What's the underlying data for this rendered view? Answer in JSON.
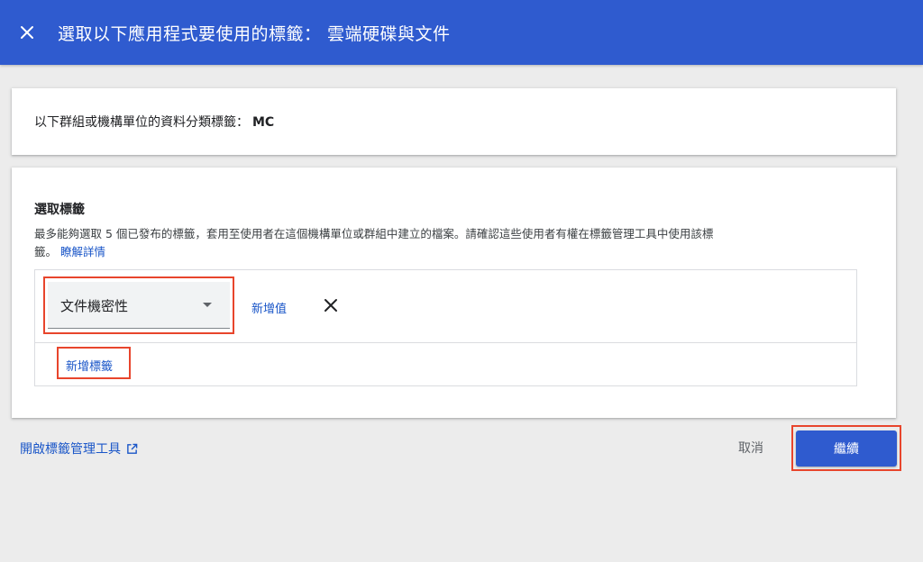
{
  "header": {
    "title": "選取以下應用程式要使用的標籤： 雲端硬碟與文件",
    "close_icon": "close-icon"
  },
  "info_card": {
    "text": "以下群組或機構單位的資料分類標籤：",
    "unit": "MC"
  },
  "select_card": {
    "title": "選取標籤",
    "description": "最多能夠選取 5 個已發布的標籤，套用至使用者在這個機構單位或群組中建立的檔案。請確認這些使用者有權在標籤管理工具中使用該標籤。",
    "learn_more": "瞭解詳情",
    "dropdown_value": "文件機密性",
    "add_value": "新增值",
    "add_label": "新增標籤"
  },
  "footer": {
    "open_tool": "開啟標籤管理工具",
    "cancel": "取消",
    "continue": "繼續"
  },
  "colors": {
    "header_bg": "#2f5bcf",
    "link": "#1a56c8",
    "highlight": "#e8452c",
    "page_bg": "#ececec"
  }
}
